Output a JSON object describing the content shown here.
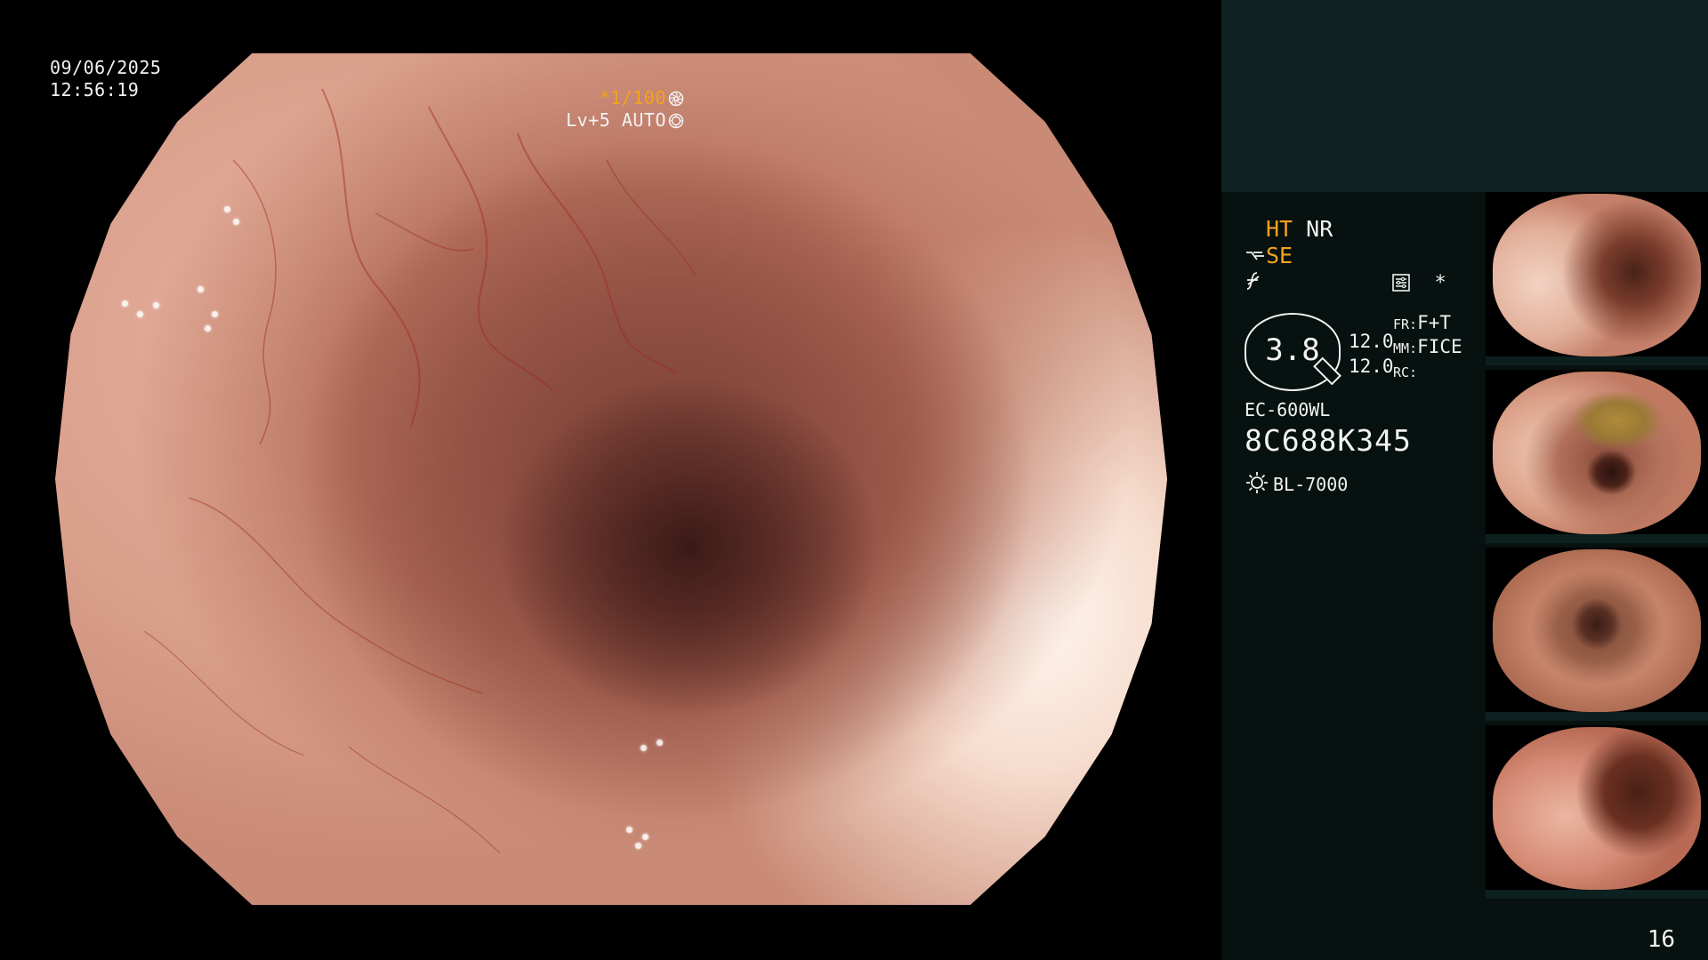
{
  "main_view": {
    "date": "09/06/2025",
    "time": "12:56:19",
    "shutter": "*1/100",
    "shutter_icon": "aperture-icon",
    "light_level": "Lv+5 AUTO",
    "light_icon": "iris-icon"
  },
  "info": {
    "ht": "HT",
    "nr": "NR",
    "se_prefix": "⪳",
    "se": "SE",
    "f_symbol": "≠",
    "menu_icon": "settings-icon",
    "asterisk": "*",
    "zoom": "3.8",
    "value_top": "12.0",
    "value_bottom": "12.0",
    "fr_label": "FR:",
    "fr_value": "F+T",
    "mm_label": "MM:",
    "mm_value": "FICE",
    "rc_label": "RC:",
    "rc_value": "",
    "scope_model": "EC-600WL",
    "serial": "8C688K345",
    "light_source": "BL-7000",
    "light_source_icon": "light-source-icon"
  },
  "page_number": "16",
  "colors": {
    "accent_orange": "#f4a21f",
    "panel_band": "#0d2221",
    "panel_bg": "#071110"
  }
}
